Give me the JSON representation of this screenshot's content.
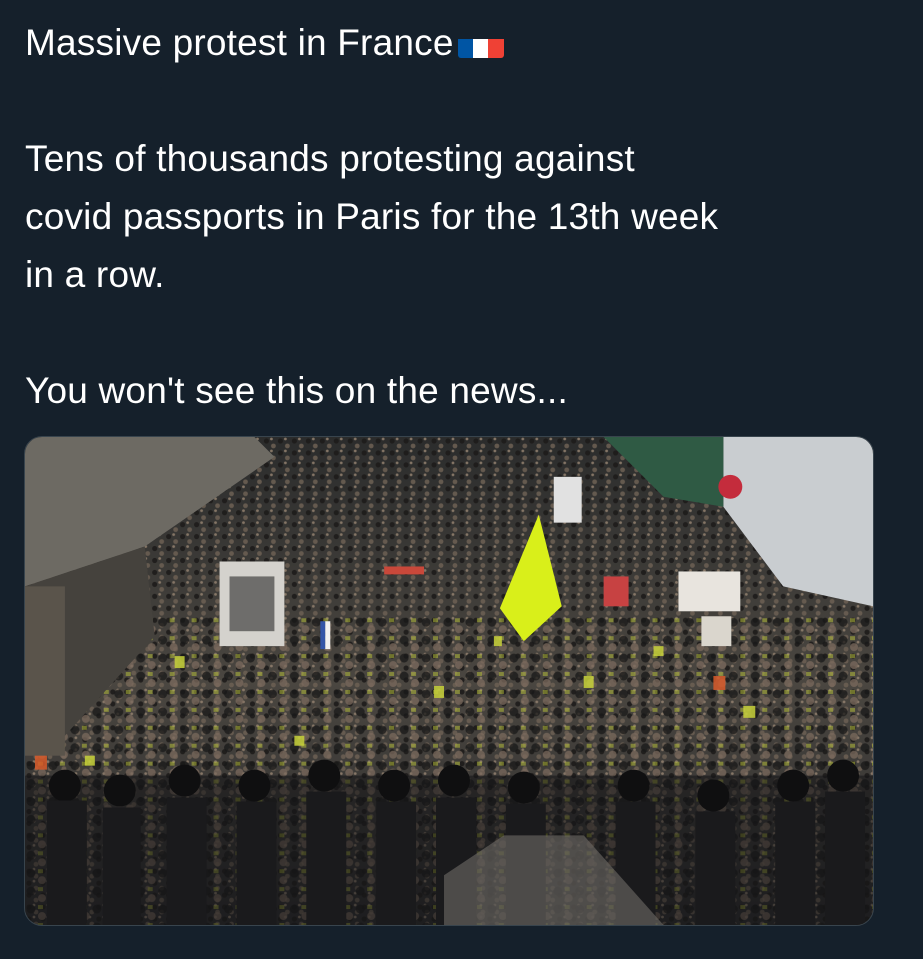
{
  "tweet": {
    "title_line": "Massive protest in France",
    "flag_icon": "france-flag-icon",
    "body_lines": [
      "Tens of thousands protesting against",
      "covid passports in Paris for the 13th week",
      "in a row."
    ],
    "closing_line": "You won't see this on the news..."
  },
  "media": {
    "icon": "photo-protest-crowd"
  },
  "colors": {
    "background": "#15202b",
    "text": "#ffffff",
    "flag_yellow": "#d9ef1a"
  }
}
